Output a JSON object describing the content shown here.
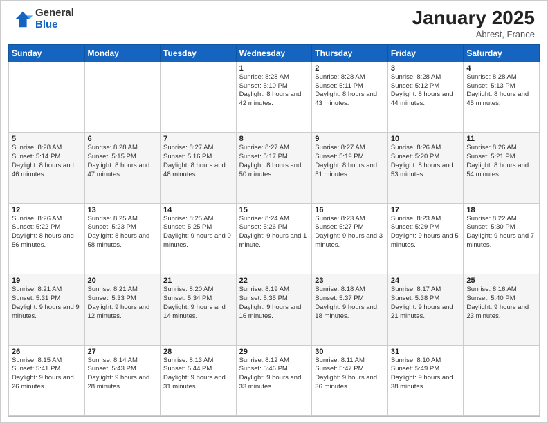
{
  "logo": {
    "general": "General",
    "blue": "Blue"
  },
  "title": "January 2025",
  "location": "Abrest, France",
  "days_header": [
    "Sunday",
    "Monday",
    "Tuesday",
    "Wednesday",
    "Thursday",
    "Friday",
    "Saturday"
  ],
  "weeks": [
    [
      {
        "day": "",
        "info": ""
      },
      {
        "day": "",
        "info": ""
      },
      {
        "day": "",
        "info": ""
      },
      {
        "day": "1",
        "info": "Sunrise: 8:28 AM\nSunset: 5:10 PM\nDaylight: 8 hours\nand 42 minutes."
      },
      {
        "day": "2",
        "info": "Sunrise: 8:28 AM\nSunset: 5:11 PM\nDaylight: 8 hours\nand 43 minutes."
      },
      {
        "day": "3",
        "info": "Sunrise: 8:28 AM\nSunset: 5:12 PM\nDaylight: 8 hours\nand 44 minutes."
      },
      {
        "day": "4",
        "info": "Sunrise: 8:28 AM\nSunset: 5:13 PM\nDaylight: 8 hours\nand 45 minutes."
      }
    ],
    [
      {
        "day": "5",
        "info": "Sunrise: 8:28 AM\nSunset: 5:14 PM\nDaylight: 8 hours\nand 46 minutes."
      },
      {
        "day": "6",
        "info": "Sunrise: 8:28 AM\nSunset: 5:15 PM\nDaylight: 8 hours\nand 47 minutes."
      },
      {
        "day": "7",
        "info": "Sunrise: 8:27 AM\nSunset: 5:16 PM\nDaylight: 8 hours\nand 48 minutes."
      },
      {
        "day": "8",
        "info": "Sunrise: 8:27 AM\nSunset: 5:17 PM\nDaylight: 8 hours\nand 50 minutes."
      },
      {
        "day": "9",
        "info": "Sunrise: 8:27 AM\nSunset: 5:19 PM\nDaylight: 8 hours\nand 51 minutes."
      },
      {
        "day": "10",
        "info": "Sunrise: 8:26 AM\nSunset: 5:20 PM\nDaylight: 8 hours\nand 53 minutes."
      },
      {
        "day": "11",
        "info": "Sunrise: 8:26 AM\nSunset: 5:21 PM\nDaylight: 8 hours\nand 54 minutes."
      }
    ],
    [
      {
        "day": "12",
        "info": "Sunrise: 8:26 AM\nSunset: 5:22 PM\nDaylight: 8 hours\nand 56 minutes."
      },
      {
        "day": "13",
        "info": "Sunrise: 8:25 AM\nSunset: 5:23 PM\nDaylight: 8 hours\nand 58 minutes."
      },
      {
        "day": "14",
        "info": "Sunrise: 8:25 AM\nSunset: 5:25 PM\nDaylight: 9 hours\nand 0 minutes."
      },
      {
        "day": "15",
        "info": "Sunrise: 8:24 AM\nSunset: 5:26 PM\nDaylight: 9 hours\nand 1 minute."
      },
      {
        "day": "16",
        "info": "Sunrise: 8:23 AM\nSunset: 5:27 PM\nDaylight: 9 hours\nand 3 minutes."
      },
      {
        "day": "17",
        "info": "Sunrise: 8:23 AM\nSunset: 5:29 PM\nDaylight: 9 hours\nand 5 minutes."
      },
      {
        "day": "18",
        "info": "Sunrise: 8:22 AM\nSunset: 5:30 PM\nDaylight: 9 hours\nand 7 minutes."
      }
    ],
    [
      {
        "day": "19",
        "info": "Sunrise: 8:21 AM\nSunset: 5:31 PM\nDaylight: 9 hours\nand 9 minutes."
      },
      {
        "day": "20",
        "info": "Sunrise: 8:21 AM\nSunset: 5:33 PM\nDaylight: 9 hours\nand 12 minutes."
      },
      {
        "day": "21",
        "info": "Sunrise: 8:20 AM\nSunset: 5:34 PM\nDaylight: 9 hours\nand 14 minutes."
      },
      {
        "day": "22",
        "info": "Sunrise: 8:19 AM\nSunset: 5:35 PM\nDaylight: 9 hours\nand 16 minutes."
      },
      {
        "day": "23",
        "info": "Sunrise: 8:18 AM\nSunset: 5:37 PM\nDaylight: 9 hours\nand 18 minutes."
      },
      {
        "day": "24",
        "info": "Sunrise: 8:17 AM\nSunset: 5:38 PM\nDaylight: 9 hours\nand 21 minutes."
      },
      {
        "day": "25",
        "info": "Sunrise: 8:16 AM\nSunset: 5:40 PM\nDaylight: 9 hours\nand 23 minutes."
      }
    ],
    [
      {
        "day": "26",
        "info": "Sunrise: 8:15 AM\nSunset: 5:41 PM\nDaylight: 9 hours\nand 26 minutes."
      },
      {
        "day": "27",
        "info": "Sunrise: 8:14 AM\nSunset: 5:43 PM\nDaylight: 9 hours\nand 28 minutes."
      },
      {
        "day": "28",
        "info": "Sunrise: 8:13 AM\nSunset: 5:44 PM\nDaylight: 9 hours\nand 31 minutes."
      },
      {
        "day": "29",
        "info": "Sunrise: 8:12 AM\nSunset: 5:46 PM\nDaylight: 9 hours\nand 33 minutes."
      },
      {
        "day": "30",
        "info": "Sunrise: 8:11 AM\nSunset: 5:47 PM\nDaylight: 9 hours\nand 36 minutes."
      },
      {
        "day": "31",
        "info": "Sunrise: 8:10 AM\nSunset: 5:49 PM\nDaylight: 9 hours\nand 38 minutes."
      },
      {
        "day": "",
        "info": ""
      }
    ]
  ]
}
